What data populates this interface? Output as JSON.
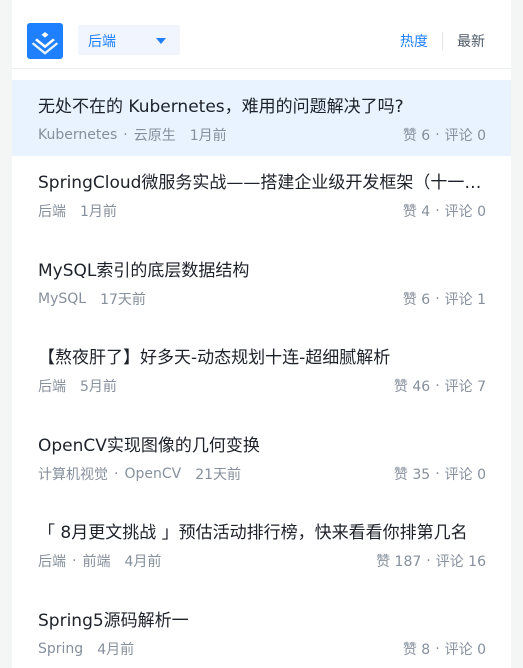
{
  "header": {
    "category": "后端",
    "sort_hot": "热度",
    "sort_new": "最新"
  },
  "colors": {
    "accent": "#1e80ff",
    "active_row": "#e8f3ff"
  },
  "articles": [
    {
      "title": "无处不在的 Kubernetes，难用的问题解决了吗?",
      "tags": [
        "Kubernetes",
        "云原生"
      ],
      "time": "1月前",
      "likes": "赞 6",
      "comments": "评论 0"
    },
    {
      "title": "SpringCloud微服务实战——搭建企业级开发框架（十一）：集成OpenFeign，实现微服务间的调用",
      "tags": [
        "后端"
      ],
      "time": "1月前",
      "likes": "赞 4",
      "comments": "评论 0"
    },
    {
      "title": "MySQL索引的底层数据结构",
      "tags": [
        "MySQL"
      ],
      "time": "17天前",
      "likes": "赞 6",
      "comments": "评论 1"
    },
    {
      "title": "【熬夜肝了】好多天-动态规划十连-超细腻解析",
      "tags": [
        "后端"
      ],
      "time": "5月前",
      "likes": "赞 46",
      "comments": "评论 7"
    },
    {
      "title": "OpenCV实现图像的几何变换",
      "tags": [
        "计算机视觉",
        "OpenCV"
      ],
      "time": "21天前",
      "likes": "赞 35",
      "comments": "评论 0"
    },
    {
      "title": "「 8月更文挑战 」预估活动排行榜，快来看看你排第几名",
      "tags": [
        "后端",
        "前端"
      ],
      "time": "4月前",
      "likes": "赞 187",
      "comments": "评论 16"
    },
    {
      "title": "Spring5源码解析一",
      "tags": [
        "Spring"
      ],
      "time": "4月前",
      "likes": "赞 8",
      "comments": "评论 0"
    }
  ]
}
